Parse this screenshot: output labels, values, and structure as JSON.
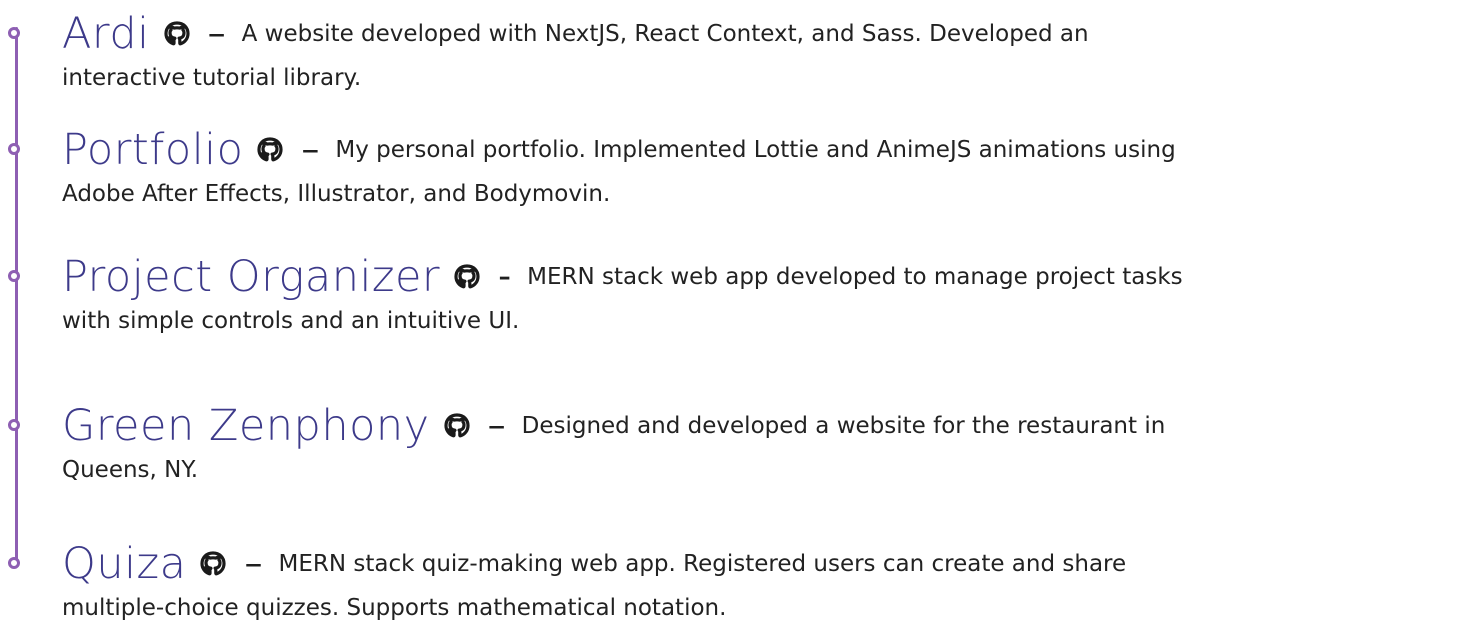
{
  "projects": [
    {
      "name": "Ardi",
      "icon": "github-icon",
      "dash": "–",
      "desc_line1": "A website developed with NextJS, React Context, and Sass. Developed an",
      "desc_line2": "interactive tutorial library."
    },
    {
      "name": "Portfolio",
      "icon": "github-icon",
      "dash": "–",
      "desc_line1": "My personal portfolio. Implemented Lottie and AnimeJS animations using",
      "desc_line2": "Adobe After Effects, Illustrator, and Bodymovin."
    },
    {
      "name": "Project Organizer",
      "icon": "github-icon",
      "dash": "-",
      "desc_line1": "MERN stack web app developed to manage project tasks",
      "desc_line2": "with simple controls and an intuitive UI."
    },
    {
      "name": "Green Zenphony",
      "icon": "github-icon",
      "dash": "–",
      "desc_line1": "Designed and developed a website for the restaurant in",
      "desc_line2": "Queens, NY."
    },
    {
      "name": "Quiza",
      "icon": "github-icon",
      "dash": "–",
      "desc_line1": "MERN stack quiz-making web app. Registered users can create and share",
      "desc_line2": "multiple-choice quizzes. Supports mathematical notation."
    }
  ],
  "colors": {
    "timeline": "#8e5fb3",
    "project_name": "#3d3a8a",
    "text": "#222222"
  }
}
